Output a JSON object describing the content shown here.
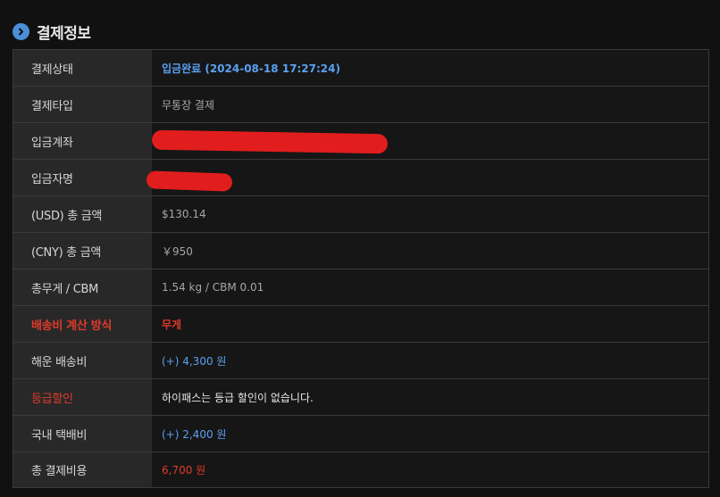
{
  "header": {
    "title": "결제정보",
    "icon": "chevron-right-icon",
    "icon_color": "#4a8fd8"
  },
  "rows": [
    {
      "label": "결제상태",
      "value": "입금완료 (2024-08-18 17:27:24)"
    },
    {
      "label": "결제타입",
      "value": "무통장 결제"
    },
    {
      "label": "입금계좌",
      "value": ""
    },
    {
      "label": "입금자명",
      "value": ""
    },
    {
      "label": "(USD) 총 금액",
      "value": "$130.14"
    },
    {
      "label": "(CNY) 총 금액",
      "value": "￥950"
    },
    {
      "label": "총무게 / CBM",
      "value": "1.54 kg / CBM 0.01"
    },
    {
      "label": "배송비 계산 방식",
      "value": "무게"
    },
    {
      "label": "해운 배송비",
      "value": "(+) 4,300 원"
    },
    {
      "label": "등급할인",
      "value": "하이패스는 등급 할인이 없습니다."
    },
    {
      "label": "국내 택배비",
      "value": "(+) 2,400 원"
    },
    {
      "label": "총 결제비용",
      "value": "6,700 원"
    }
  ],
  "colors": {
    "accent_blue": "#5aa0f0",
    "accent_red": "#e03a2b",
    "redaction": "#e11d1d"
  }
}
